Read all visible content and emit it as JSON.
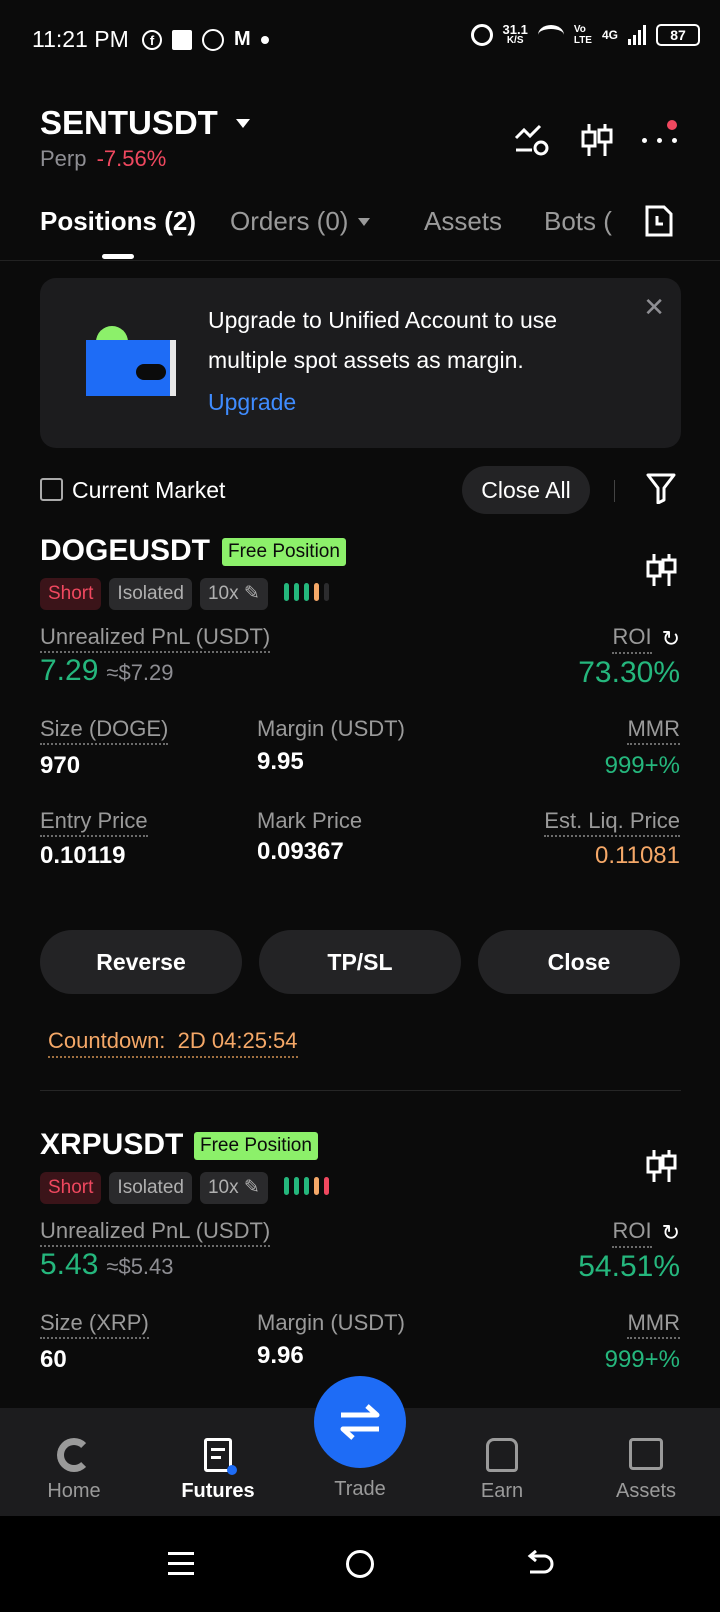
{
  "status_bar": {
    "time": "11:21 PM",
    "speed": "31.1",
    "speed_unit": "K/S",
    "volte": "Vo\nLTE",
    "network": "4G",
    "battery": "87"
  },
  "header": {
    "symbol": "SENTUSDT",
    "type": "Perp",
    "change": "-7.56%"
  },
  "tabs": [
    {
      "label": "Positions (2)"
    },
    {
      "label": "Orders (0)"
    },
    {
      "label": "Assets"
    },
    {
      "label": "Bots ("
    }
  ],
  "banner": {
    "text": "Upgrade to Unified Account to use multiple spot assets as margin.",
    "link": "Upgrade"
  },
  "filter": {
    "current_market": "Current Market",
    "close_all": "Close All"
  },
  "positions": [
    {
      "symbol": "DOGEUSDT",
      "badge": "Free Position",
      "side": "Short",
      "margin_mode": "Isolated",
      "leverage": "10x",
      "pnl_label": "Unrealized PnL (USDT)",
      "pnl": "7.29",
      "pnl_usd": "≈$7.29",
      "roi_label": "ROI",
      "roi": "73.30%",
      "size_label": "Size (DOGE)",
      "size": "970",
      "margin_label": "Margin (USDT)",
      "margin": "9.95",
      "mmr_label": "MMR",
      "mmr": "999+%",
      "entry_label": "Entry Price",
      "entry": "0.10119",
      "mark_label": "Mark Price",
      "mark": "0.09367",
      "liq_label": "Est. Liq. Price",
      "liq": "0.11081",
      "countdown_label": "Countdown:",
      "countdown": "2D 04:25:54"
    },
    {
      "symbol": "XRPUSDT",
      "badge": "Free Position",
      "side": "Short",
      "margin_mode": "Isolated",
      "leverage": "10x",
      "pnl_label": "Unrealized PnL (USDT)",
      "pnl": "5.43",
      "pnl_usd": "≈$5.43",
      "roi_label": "ROI",
      "roi": "54.51%",
      "size_label": "Size (XRP)",
      "size": "60",
      "margin_label": "Margin (USDT)",
      "margin": "9.96",
      "mmr_label": "MMR",
      "mmr": "999+%"
    }
  ],
  "actions": {
    "reverse": "Reverse",
    "tpsl": "TP/SL",
    "close": "Close"
  },
  "bottom_nav": [
    {
      "label": "Home"
    },
    {
      "label": "Futures"
    },
    {
      "label": "Trade"
    },
    {
      "label": "Earn"
    },
    {
      "label": "Assets"
    }
  ],
  "colors": {
    "green": "#25b77d",
    "red": "#f0485f",
    "orange": "#f5a868",
    "blue": "#1e6cf6",
    "badge": "#8cf06a"
  }
}
